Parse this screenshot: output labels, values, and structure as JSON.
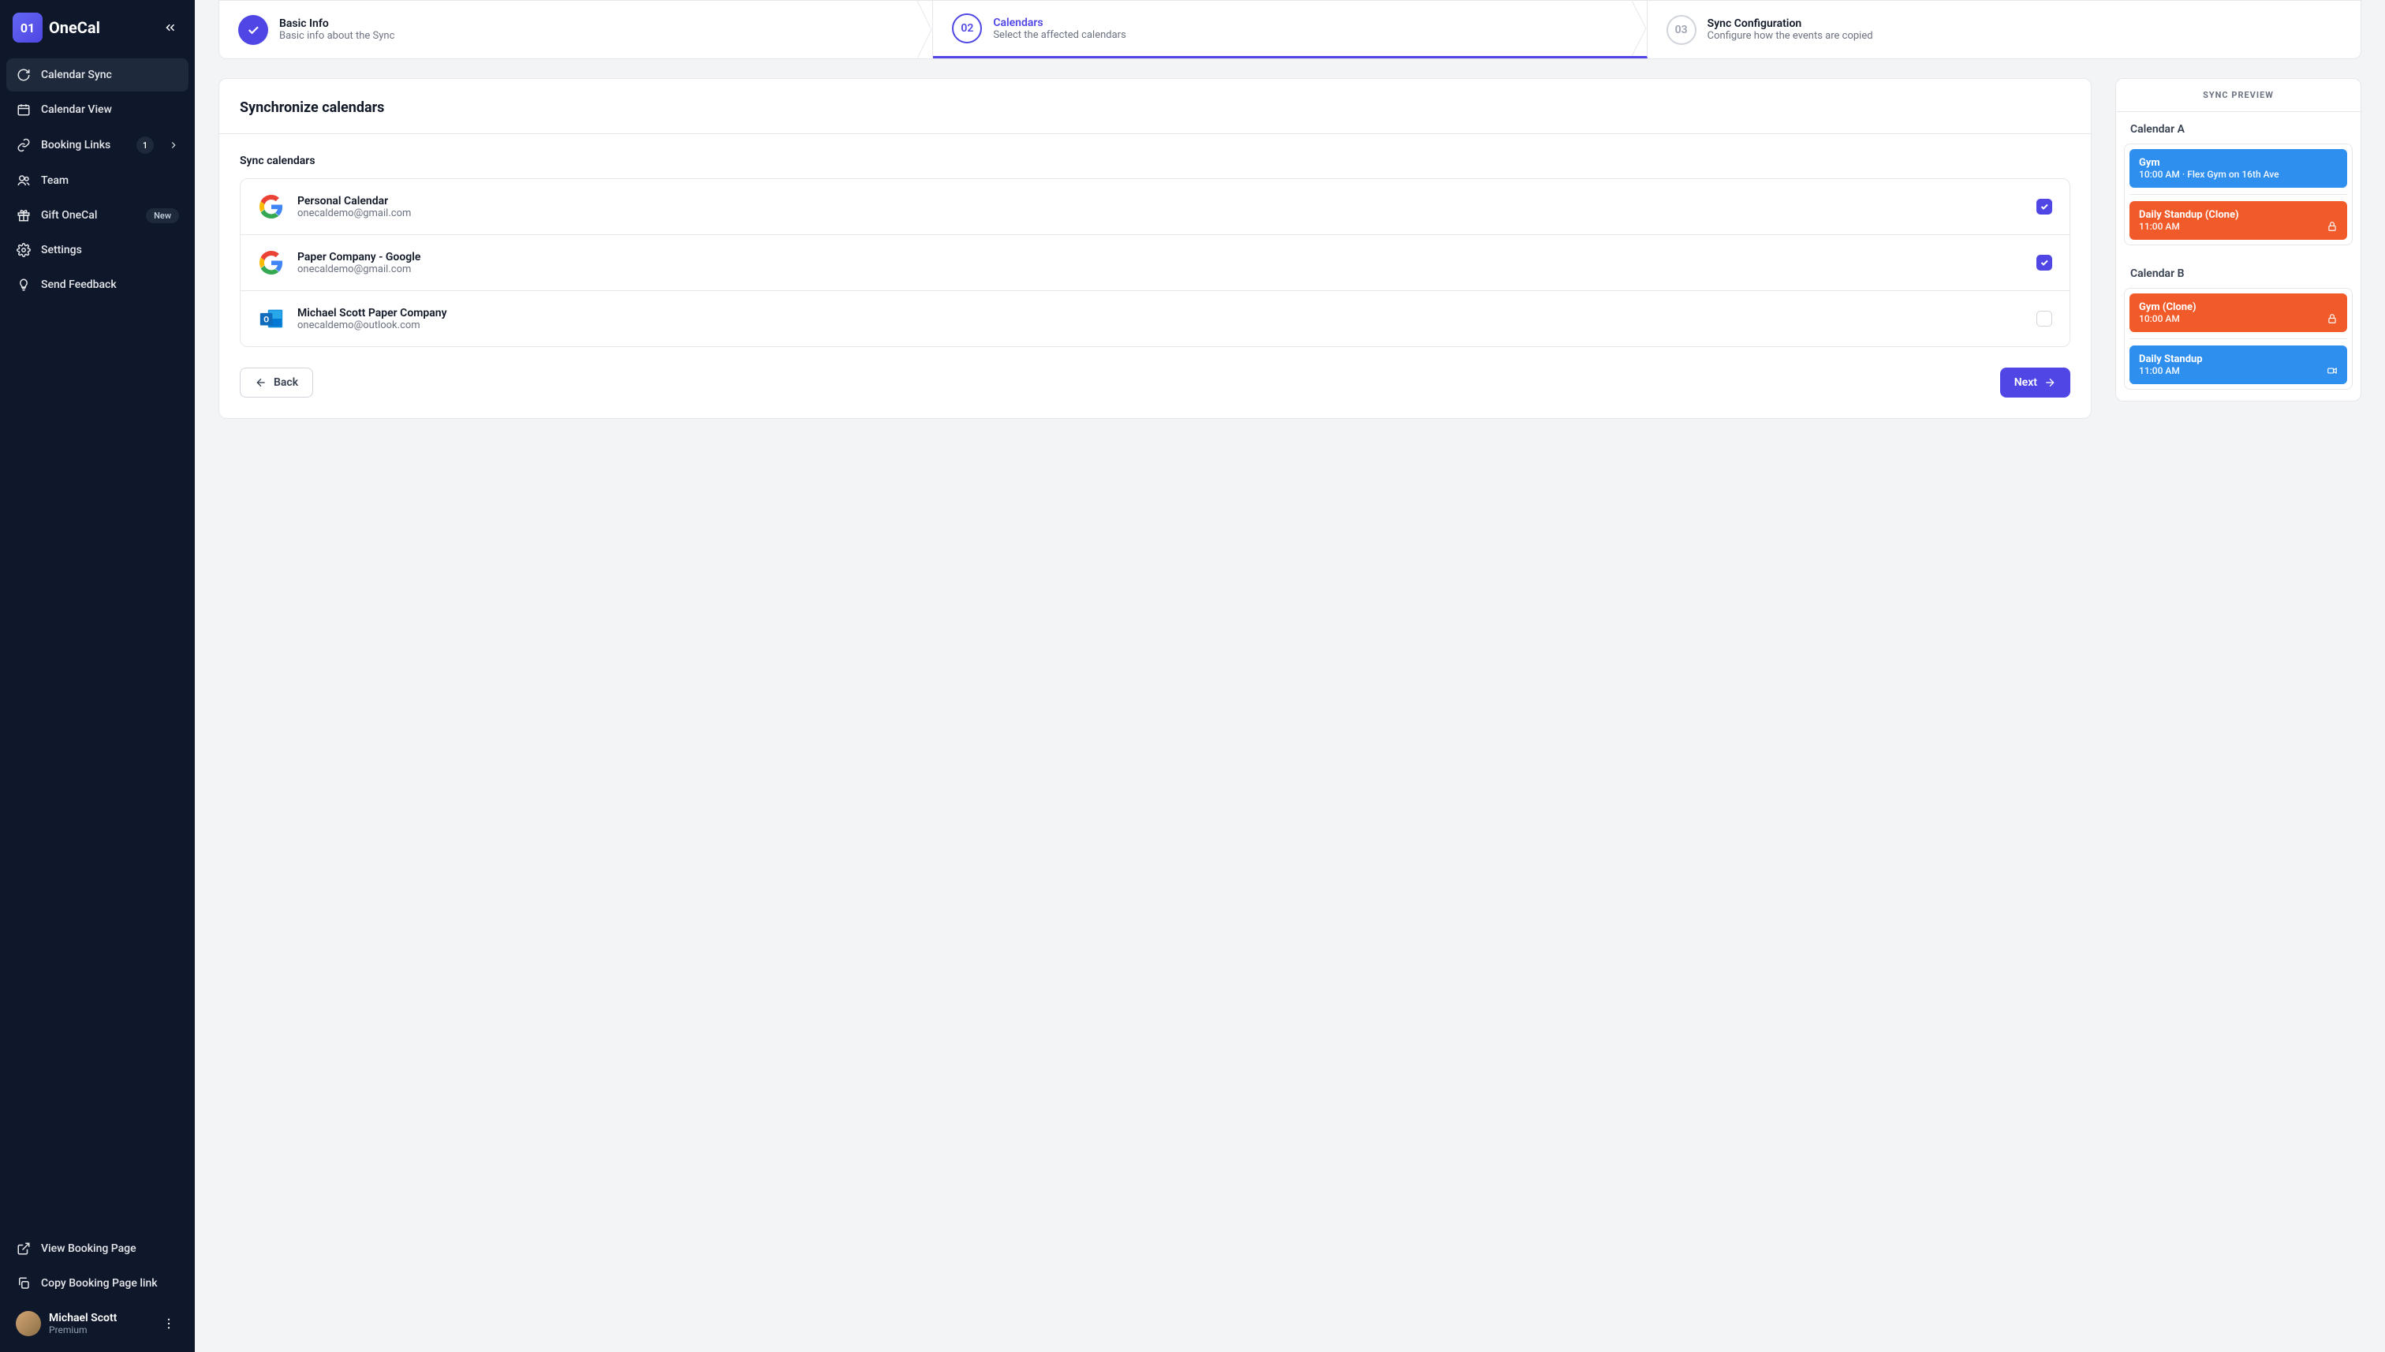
{
  "brand": {
    "mark": "01",
    "name": "OneCal"
  },
  "sidebar": {
    "items": [
      {
        "label": "Calendar Sync"
      },
      {
        "label": "Calendar View"
      },
      {
        "label": "Booking Links",
        "badge": "1"
      },
      {
        "label": "Team"
      },
      {
        "label": "Gift OneCal",
        "tag": "New"
      },
      {
        "label": "Settings"
      },
      {
        "label": "Send Feedback"
      }
    ],
    "footer": [
      {
        "label": "View Booking Page"
      },
      {
        "label": "Copy Booking Page link"
      }
    ],
    "user": {
      "name": "Michael Scott",
      "plan": "Premium"
    }
  },
  "stepper": [
    {
      "num": "✓",
      "title": "Basic Info",
      "sub": "Basic info about the Sync"
    },
    {
      "num": "02",
      "title": "Calendars",
      "sub": "Select the affected calendars"
    },
    {
      "num": "03",
      "title": "Sync Configuration",
      "sub": "Configure how the events are copied"
    }
  ],
  "panel": {
    "title": "Synchronize calendars",
    "section": "Sync calendars",
    "calendars": [
      {
        "name": "Personal Calendar",
        "email": "onecaldemo@gmail.com",
        "provider": "google",
        "checked": true
      },
      {
        "name": "Paper Company - Google",
        "email": "onecaldemo@gmail.com",
        "provider": "google",
        "checked": true
      },
      {
        "name": "Michael Scott Paper Company",
        "email": "onecaldemo@outlook.com",
        "provider": "outlook",
        "checked": false
      }
    ],
    "back": "Back",
    "next": "Next"
  },
  "preview": {
    "header": "SYNC PREVIEW",
    "a_title": "Calendar A",
    "b_title": "Calendar B",
    "a": [
      {
        "title": "Gym",
        "time": "10:00 AM · Flex Gym on 16th Ave",
        "color": "blue"
      },
      {
        "title": "Daily Standup (Clone)",
        "time": "11:00 AM",
        "color": "orange",
        "icon": "lock"
      }
    ],
    "b": [
      {
        "title": "Gym (Clone)",
        "time": "10:00 AM",
        "color": "orange",
        "icon": "lock"
      },
      {
        "title": "Daily Standup",
        "time": "11:00 AM",
        "color": "blue",
        "icon": "video"
      }
    ]
  }
}
